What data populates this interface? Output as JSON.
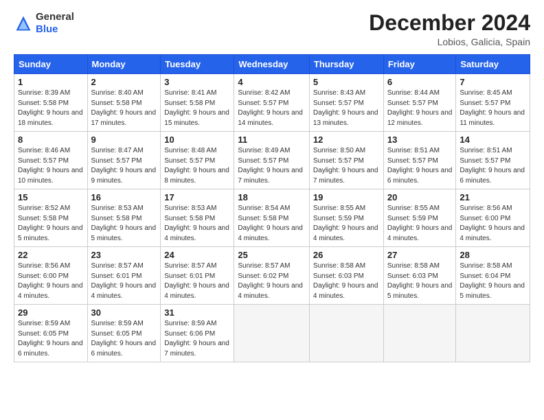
{
  "header": {
    "logo_general": "General",
    "logo_blue": "Blue",
    "month_title": "December 2024",
    "subtitle": "Lobios, Galicia, Spain"
  },
  "weekdays": [
    "Sunday",
    "Monday",
    "Tuesday",
    "Wednesday",
    "Thursday",
    "Friday",
    "Saturday"
  ],
  "weeks": [
    [
      {
        "day": "1",
        "sunrise": "Sunrise: 8:39 AM",
        "sunset": "Sunset: 5:58 PM",
        "daylight": "Daylight: 9 hours and 18 minutes."
      },
      {
        "day": "2",
        "sunrise": "Sunrise: 8:40 AM",
        "sunset": "Sunset: 5:58 PM",
        "daylight": "Daylight: 9 hours and 17 minutes."
      },
      {
        "day": "3",
        "sunrise": "Sunrise: 8:41 AM",
        "sunset": "Sunset: 5:58 PM",
        "daylight": "Daylight: 9 hours and 15 minutes."
      },
      {
        "day": "4",
        "sunrise": "Sunrise: 8:42 AM",
        "sunset": "Sunset: 5:57 PM",
        "daylight": "Daylight: 9 hours and 14 minutes."
      },
      {
        "day": "5",
        "sunrise": "Sunrise: 8:43 AM",
        "sunset": "Sunset: 5:57 PM",
        "daylight": "Daylight: 9 hours and 13 minutes."
      },
      {
        "day": "6",
        "sunrise": "Sunrise: 8:44 AM",
        "sunset": "Sunset: 5:57 PM",
        "daylight": "Daylight: 9 hours and 12 minutes."
      },
      {
        "day": "7",
        "sunrise": "Sunrise: 8:45 AM",
        "sunset": "Sunset: 5:57 PM",
        "daylight": "Daylight: 9 hours and 11 minutes."
      }
    ],
    [
      {
        "day": "8",
        "sunrise": "Sunrise: 8:46 AM",
        "sunset": "Sunset: 5:57 PM",
        "daylight": "Daylight: 9 hours and 10 minutes."
      },
      {
        "day": "9",
        "sunrise": "Sunrise: 8:47 AM",
        "sunset": "Sunset: 5:57 PM",
        "daylight": "Daylight: 9 hours and 9 minutes."
      },
      {
        "day": "10",
        "sunrise": "Sunrise: 8:48 AM",
        "sunset": "Sunset: 5:57 PM",
        "daylight": "Daylight: 9 hours and 8 minutes."
      },
      {
        "day": "11",
        "sunrise": "Sunrise: 8:49 AM",
        "sunset": "Sunset: 5:57 PM",
        "daylight": "Daylight: 9 hours and 7 minutes."
      },
      {
        "day": "12",
        "sunrise": "Sunrise: 8:50 AM",
        "sunset": "Sunset: 5:57 PM",
        "daylight": "Daylight: 9 hours and 7 minutes."
      },
      {
        "day": "13",
        "sunrise": "Sunrise: 8:51 AM",
        "sunset": "Sunset: 5:57 PM",
        "daylight": "Daylight: 9 hours and 6 minutes."
      },
      {
        "day": "14",
        "sunrise": "Sunrise: 8:51 AM",
        "sunset": "Sunset: 5:57 PM",
        "daylight": "Daylight: 9 hours and 6 minutes."
      }
    ],
    [
      {
        "day": "15",
        "sunrise": "Sunrise: 8:52 AM",
        "sunset": "Sunset: 5:58 PM",
        "daylight": "Daylight: 9 hours and 5 minutes."
      },
      {
        "day": "16",
        "sunrise": "Sunrise: 8:53 AM",
        "sunset": "Sunset: 5:58 PM",
        "daylight": "Daylight: 9 hours and 5 minutes."
      },
      {
        "day": "17",
        "sunrise": "Sunrise: 8:53 AM",
        "sunset": "Sunset: 5:58 PM",
        "daylight": "Daylight: 9 hours and 4 minutes."
      },
      {
        "day": "18",
        "sunrise": "Sunrise: 8:54 AM",
        "sunset": "Sunset: 5:58 PM",
        "daylight": "Daylight: 9 hours and 4 minutes."
      },
      {
        "day": "19",
        "sunrise": "Sunrise: 8:55 AM",
        "sunset": "Sunset: 5:59 PM",
        "daylight": "Daylight: 9 hours and 4 minutes."
      },
      {
        "day": "20",
        "sunrise": "Sunrise: 8:55 AM",
        "sunset": "Sunset: 5:59 PM",
        "daylight": "Daylight: 9 hours and 4 minutes."
      },
      {
        "day": "21",
        "sunrise": "Sunrise: 8:56 AM",
        "sunset": "Sunset: 6:00 PM",
        "daylight": "Daylight: 9 hours and 4 minutes."
      }
    ],
    [
      {
        "day": "22",
        "sunrise": "Sunrise: 8:56 AM",
        "sunset": "Sunset: 6:00 PM",
        "daylight": "Daylight: 9 hours and 4 minutes."
      },
      {
        "day": "23",
        "sunrise": "Sunrise: 8:57 AM",
        "sunset": "Sunset: 6:01 PM",
        "daylight": "Daylight: 9 hours and 4 minutes."
      },
      {
        "day": "24",
        "sunrise": "Sunrise: 8:57 AM",
        "sunset": "Sunset: 6:01 PM",
        "daylight": "Daylight: 9 hours and 4 minutes."
      },
      {
        "day": "25",
        "sunrise": "Sunrise: 8:57 AM",
        "sunset": "Sunset: 6:02 PM",
        "daylight": "Daylight: 9 hours and 4 minutes."
      },
      {
        "day": "26",
        "sunrise": "Sunrise: 8:58 AM",
        "sunset": "Sunset: 6:03 PM",
        "daylight": "Daylight: 9 hours and 4 minutes."
      },
      {
        "day": "27",
        "sunrise": "Sunrise: 8:58 AM",
        "sunset": "Sunset: 6:03 PM",
        "daylight": "Daylight: 9 hours and 5 minutes."
      },
      {
        "day": "28",
        "sunrise": "Sunrise: 8:58 AM",
        "sunset": "Sunset: 6:04 PM",
        "daylight": "Daylight: 9 hours and 5 minutes."
      }
    ],
    [
      {
        "day": "29",
        "sunrise": "Sunrise: 8:59 AM",
        "sunset": "Sunset: 6:05 PM",
        "daylight": "Daylight: 9 hours and 6 minutes."
      },
      {
        "day": "30",
        "sunrise": "Sunrise: 8:59 AM",
        "sunset": "Sunset: 6:05 PM",
        "daylight": "Daylight: 9 hours and 6 minutes."
      },
      {
        "day": "31",
        "sunrise": "Sunrise: 8:59 AM",
        "sunset": "Sunset: 6:06 PM",
        "daylight": "Daylight: 9 hours and 7 minutes."
      },
      null,
      null,
      null,
      null
    ]
  ]
}
